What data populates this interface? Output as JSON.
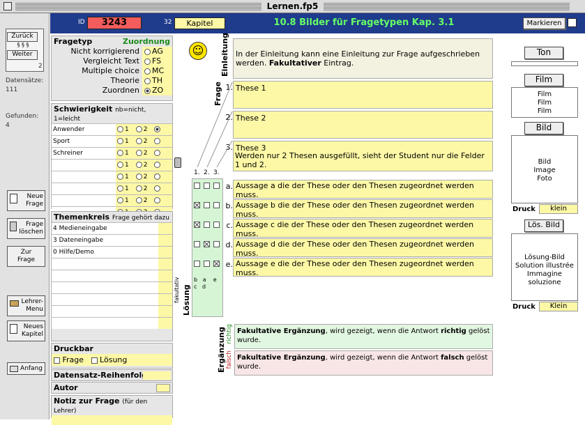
{
  "window": {
    "title": "Lernen.fp5"
  },
  "left": {
    "nav_back": "Zurück",
    "nav_forward": "Weiter",
    "page_no": "2",
    "records_label": "Datensätze:",
    "records": "111",
    "found_label": "Gefunden:",
    "found": "4",
    "buttons": [
      {
        "l1": "Neue",
        "l2": "Frage"
      },
      {
        "l1": "Frage",
        "l2": "löschen"
      },
      {
        "l1": "Zur",
        "l2": "Frage"
      },
      {
        "l1": "Lehrer-",
        "l2": "Menu"
      },
      {
        "l1": "Neues",
        "l2": "Kapitel"
      },
      {
        "l1": "Anfang",
        "l2": ""
      }
    ]
  },
  "header": {
    "id_label": "ID",
    "id": "3243",
    "chapter_no": "32",
    "chapter": "Kapitel",
    "title": "10.8 Bilder für Fragetypen Kap. 3.1",
    "mark_button": "Markieren"
  },
  "fragetyp": {
    "title": "Fragetyp",
    "value": "Zuordnung",
    "options": [
      {
        "label": "Nicht korrigierend",
        "code": "AG"
      },
      {
        "label": "Vergleicht Text",
        "code": "FS"
      },
      {
        "label": "Multiple choice",
        "code": "MC"
      },
      {
        "label": "Theorie",
        "code": "TH"
      },
      {
        "label": "Zuordnen",
        "code": "ZO"
      }
    ]
  },
  "schwierigkeit": {
    "title": "Schwierigkeit",
    "hint": "nb=nicht, 1=leicht",
    "rows": [
      "Anwender",
      "Sport",
      "Schreiner",
      "",
      "",
      "",
      "",
      ""
    ],
    "l1": "1",
    "l2": "2",
    "l3": "3"
  },
  "themenkreis": {
    "title": "Themenkreis",
    "hint": "Frage gehört dazu",
    "rows": [
      "4 Medieneingabe",
      "3 Dateneingabe",
      "0 Hilfe/Demo"
    ],
    "side": "fakultativ"
  },
  "druckbar": {
    "title": "Druckbar",
    "frage": "Frage",
    "loesung": "Lösung"
  },
  "reihenfolge": {
    "title": "Datensatz-Reihenfolge"
  },
  "autor": {
    "title": "Autor"
  },
  "notiz": {
    "title": "Notiz zur Frage",
    "hint": "(für den Lehrer)"
  },
  "einleitung": {
    "label": "Einleitung",
    "text1": "In der Einleitung kann eine Einleitung zur Frage aufgeschrieben werden. ",
    "bold": "Fakultativer",
    "text2": " Eintrag."
  },
  "frage": {
    "label": "Frage",
    "theses": [
      {
        "n": "1.",
        "t": "These 1"
      },
      {
        "n": "2.",
        "t": "These 2"
      },
      {
        "n": "3.",
        "t": "These 3"
      }
    ],
    "note": "Werden nur 2 Thesen ausgefüllt, sieht der Student nur die Felder 1 und 2."
  },
  "loesung": {
    "label": "Lösung",
    "h1": "1.",
    "h2": "2.",
    "h3": "3.",
    "key1": "b",
    "key2": "a",
    "key3": "e",
    "key4": "c",
    "key5": "d"
  },
  "aussagen": [
    {
      "n": "a.",
      "t": "Aussage a die der These oder den Thesen zugeordnet werden muss."
    },
    {
      "n": "b.",
      "t": "Aussage b die der These oder den Thesen zugeordnet werden muss."
    },
    {
      "n": "c.",
      "t": "Aussage c die der These oder den Thesen zugeordnet werden muss."
    },
    {
      "n": "d.",
      "t": "Aussage d die der These oder den Thesen zugeordnet werden muss."
    },
    {
      "n": "e.",
      "t": "Aussage e die der These oder den Thesen zugeordnet werden muss."
    }
  ],
  "ergaenzung": {
    "label": "Ergänzung",
    "richtig": "richtig",
    "falsch": "falsch",
    "r_b1": "Fakultative Ergänzung",
    "r_t1": ", wird gezeigt, wenn die Antwort ",
    "r_b2": "richtig",
    "r_t2": " gelöst wurde.",
    "f_b1": "Fakultative Ergänzung",
    "f_t1": ", wird gezeigt, wenn die Antwort ",
    "f_b2": "falsch",
    "f_t2": " gelöst wurde."
  },
  "right": {
    "ton": "Ton",
    "film": "Film",
    "film_lines": [
      "Film",
      "Film",
      "Film"
    ],
    "bild": "Bild",
    "bild_lines": [
      "Bild",
      "Image",
      "Foto"
    ],
    "druck": "Druck",
    "klein": "klein",
    "loes_bild": "Lös. Bild",
    "loes_lines": [
      "Lösung-Bild",
      "Solution illustrée",
      "Immagine soluzione"
    ],
    "druck2": "Druck",
    "klein2": "Klein"
  },
  "colors": {
    "header": "#1f3b8c",
    "yellow": "#fdf8a6",
    "green": "#d9f5d9",
    "red": "#f8e6e6"
  }
}
